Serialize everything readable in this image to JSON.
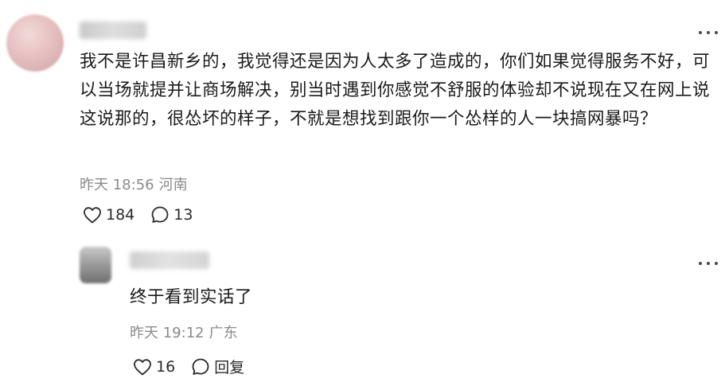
{
  "comment": {
    "text": "我不是许昌新乡的，我觉得还是因为人太多了造成的，你们如果觉得服务不好，可以当场就提并让商场解决，别当时遇到你感觉不舒服的体验却不说现在又在网上说这说那的，很怂坏的样子，不就是想找到跟你一个怂样的人一块搞网暴吗？",
    "time": "昨天 18:56",
    "location": "河南",
    "likes": "184",
    "replies": "13",
    "icons": {
      "like": "heart-outline-icon",
      "comment": "speech-bubble-icon",
      "more": "more-dots-icon"
    }
  },
  "reply": {
    "text": "终于看到实话了",
    "time": "昨天 19:12",
    "location": "广东",
    "likes": "16",
    "reply_label": "回复"
  }
}
